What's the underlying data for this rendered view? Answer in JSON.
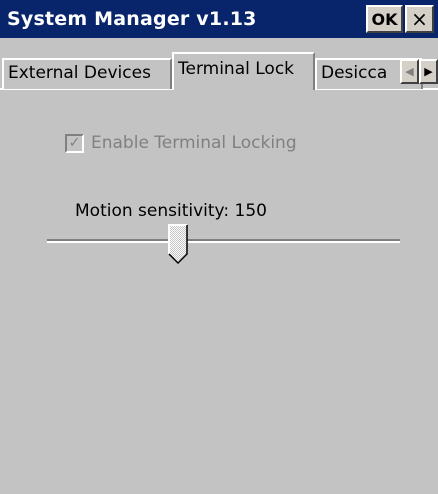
{
  "window": {
    "title": "System Manager v1.13",
    "ok_label": "OK",
    "close_label": "×"
  },
  "tabs": [
    {
      "label": "External Devices",
      "selected": false
    },
    {
      "label": "Terminal Lock",
      "selected": true
    },
    {
      "label": "Desicca",
      "selected": false
    }
  ],
  "tab_scroll": {
    "left_icon": "◀",
    "right_icon": "▶"
  },
  "terminal_lock": {
    "enable_locking": {
      "label": "Enable Terminal Locking",
      "checked": true,
      "disabled": true,
      "check_glyph": "✓"
    },
    "motion_sensitivity": {
      "label": "Motion sensitivity: 150",
      "value": 150,
      "fraction": 0.37
    }
  },
  "colors": {
    "titlebar": "#08246b",
    "background": "#c3c3c3"
  }
}
